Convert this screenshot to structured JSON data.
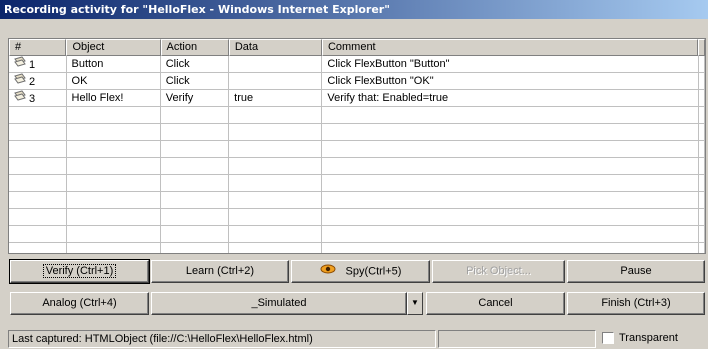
{
  "window": {
    "title": "Recording activity for \"HelloFlex - Windows Internet Explorer\""
  },
  "table": {
    "columns": [
      "#",
      "Object",
      "Action",
      "Data",
      "Comment"
    ],
    "rows": [
      {
        "num": "1",
        "object": "Button",
        "action": "Click",
        "data": "",
        "comment": "Click FlexButton \"Button\""
      },
      {
        "num": "2",
        "object": "OK",
        "action": "Click",
        "data": "",
        "comment": "Click FlexButton \"OK\""
      },
      {
        "num": "3",
        "object": "Hello Flex!",
        "action": "Verify",
        "data": "true",
        "comment": "Verify that: Enabled=true"
      }
    ],
    "row_icon": "play-step-icon",
    "empty_rows": 9
  },
  "buttons": {
    "verify": "Verify (Ctrl+1)",
    "learn": "Learn (Ctrl+2)",
    "spy": "Spy(Ctrl+5)",
    "spy_icon": "eye-icon",
    "pick_object": "Pick Object...",
    "pause": "Pause",
    "analog": "Analog (Ctrl+4)",
    "mode_value": "_Simulated",
    "cancel": "Cancel",
    "finish": "Finish (Ctrl+3)"
  },
  "status": {
    "last_captured": "Last captured: HTMLObject (file://C:\\HelloFlex\\HelloFlex.html)",
    "transparent_label": "Transparent",
    "transparent_checked": false
  },
  "colors": {
    "titlebar_start": "#0a246a",
    "titlebar_end": "#a6caf0",
    "face": "#d4d0c8"
  }
}
